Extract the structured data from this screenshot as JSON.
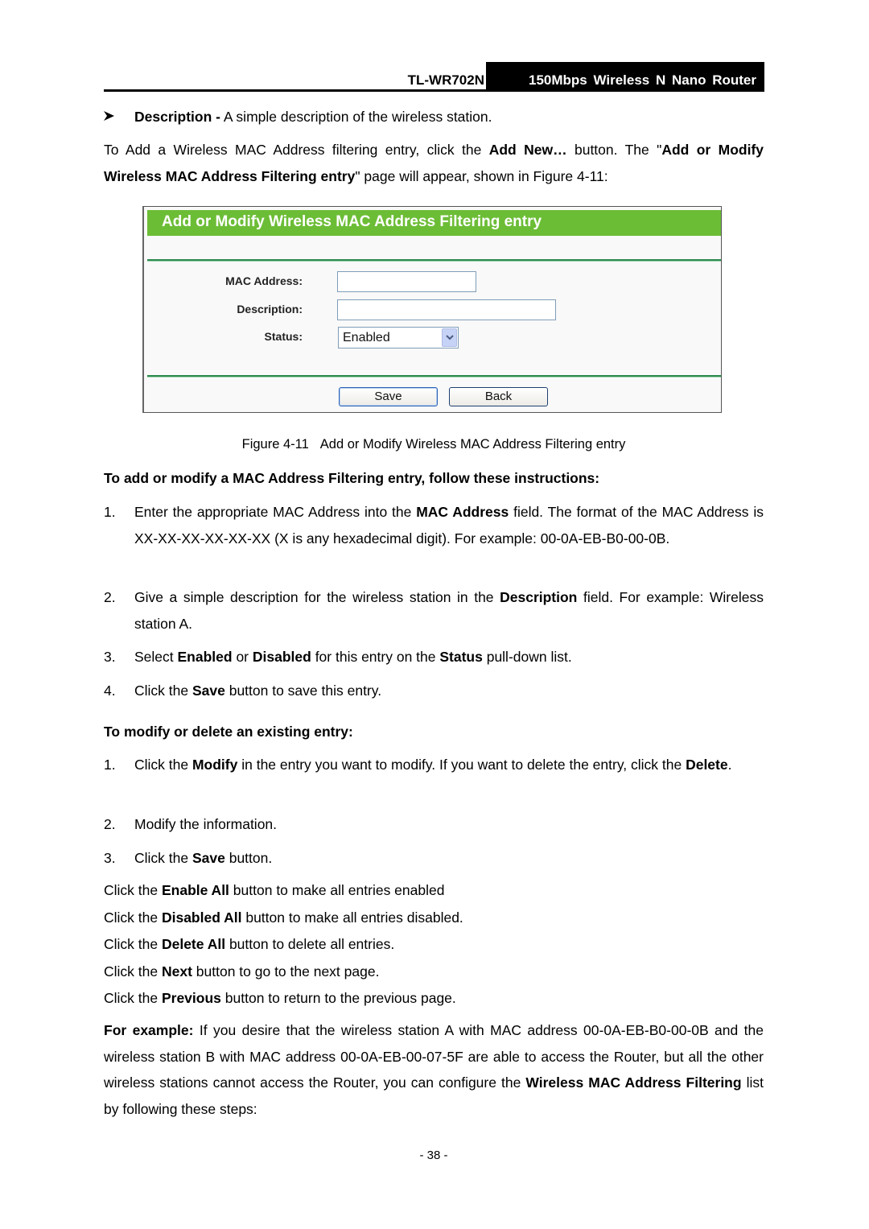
{
  "header": {
    "model": "TL-WR702N",
    "product": "150Mbps Wireless N Nano Router"
  },
  "bullet": {
    "icon": "arrow-bullet-icon",
    "term": "Description -",
    "text": " A simple description of the wireless station."
  },
  "intro": {
    "p1": "To Add a Wireless MAC Address filtering entry, click the ",
    "b1": "Add New…",
    "p2": " button. The \"",
    "b2": "Add or Modify Wireless MAC Address Filtering entry",
    "p3": "\" page will appear, shown in Figure 4-11:"
  },
  "figure": {
    "title": "Add or Modify Wireless MAC Address Filtering entry",
    "fields": {
      "mac_label": "MAC Address:",
      "mac_value": "",
      "desc_label": "Description:",
      "desc_value": "",
      "status_label": "Status:",
      "status_value": "Enabled"
    },
    "buttons": {
      "save": "Save",
      "back": "Back"
    },
    "caption_num": "Figure 4-11",
    "caption_text": "Add or Modify Wireless MAC Address Filtering entry"
  },
  "instructions": {
    "heading": "To add or modify a MAC Address Filtering entry, follow these instructions:",
    "items": [
      {
        "num": "1.",
        "a": "Enter the appropriate MAC Address into the ",
        "b": "MAC Address",
        "c": " field. The format of the MAC Address is XX-XX-XX-XX-XX-XX (X is any hexadecimal digit). For example: 00-0A-EB-B0-00-0B."
      },
      {
        "num": "2.",
        "a": "Give a simple description for the wireless station in the ",
        "b": "Description",
        "c": " field. For example: Wireless station A."
      },
      {
        "num": "3.",
        "a": "Select ",
        "b": "Enabled",
        "c": " or ",
        "d": "Disabled",
        "e": " for this entry on the ",
        "f": "Status",
        "g": " pull-down list."
      },
      {
        "num": "4.",
        "a": "Click the ",
        "b": "Save",
        "c": " button to save this entry."
      }
    ]
  },
  "modify": {
    "heading": "To modify or delete an existing entry:",
    "items": [
      {
        "num": "1.",
        "a": "Click the ",
        "b": "Modify",
        "c": " in the entry you want to modify. If you want to delete the entry, click the ",
        "d": "Delete",
        "e": "."
      },
      {
        "num": "2.",
        "a": "Modify the information."
      },
      {
        "num": "3.",
        "a": "Click the ",
        "b": "Save",
        "c": " button."
      }
    ]
  },
  "actions": [
    {
      "a": "Click the ",
      "b": "Enable All",
      "c": " button to make all entries enabled"
    },
    {
      "a": "Click the ",
      "b": "Disabled All",
      "c": " button to make all entries disabled."
    },
    {
      "a": "Click the ",
      "b": "Delete All",
      "c": " button to delete all entries."
    },
    {
      "a": "Click the ",
      "b": "Next",
      "c": " button to go to the next page."
    },
    {
      "a": "Click the ",
      "b": "Previous",
      "c": " button to return to the previous page."
    }
  ],
  "example": {
    "label": "For example:",
    "p1": " If you desire that the wireless station A with MAC address 00-0A-EB-B0-00-0B and the wireless station B with MAC address 00-0A-EB-00-07-5F are able to access the Router, but all the other wireless stations cannot access the Router, you can configure the ",
    "b1": "Wireless MAC Address Filtering",
    "p2": " list by following these steps:"
  },
  "footer": {
    "page": "- 38 -"
  }
}
